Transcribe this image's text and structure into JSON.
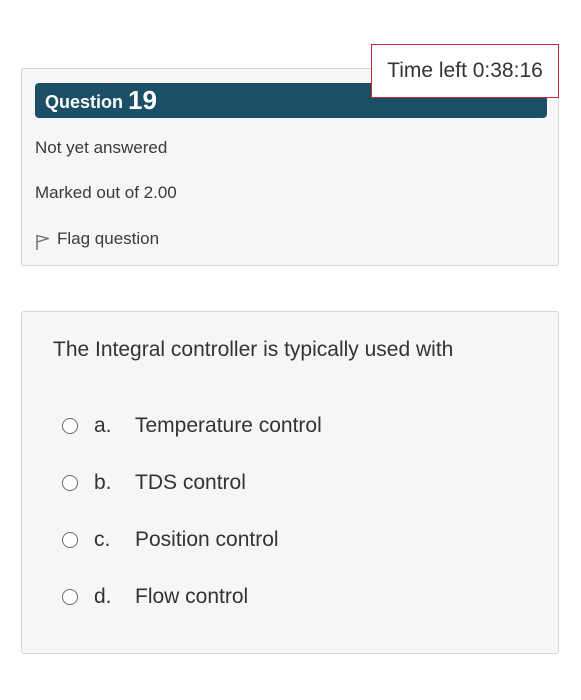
{
  "question_info": {
    "question_word": "Question",
    "question_number": "19",
    "status": "Not yet answered",
    "marks": "Marked out of 2.00",
    "flag_label": "Flag question"
  },
  "timer": {
    "text": "Time left 0:38:16"
  },
  "question": {
    "text": "The Integral controller is typically used with",
    "options": [
      {
        "letter": "a.",
        "label": "Temperature control"
      },
      {
        "letter": "b.",
        "label": "TDS control"
      },
      {
        "letter": "c.",
        "label": "Position control"
      },
      {
        "letter": "d.",
        "label": "Flow control"
      }
    ]
  },
  "colors": {
    "header_bg": "#1b4f66",
    "card_bg": "#f5f6f8",
    "timer_border": "#c8283a"
  },
  "icons": {
    "flag": "flag-icon",
    "radio": "radio-unchecked"
  }
}
